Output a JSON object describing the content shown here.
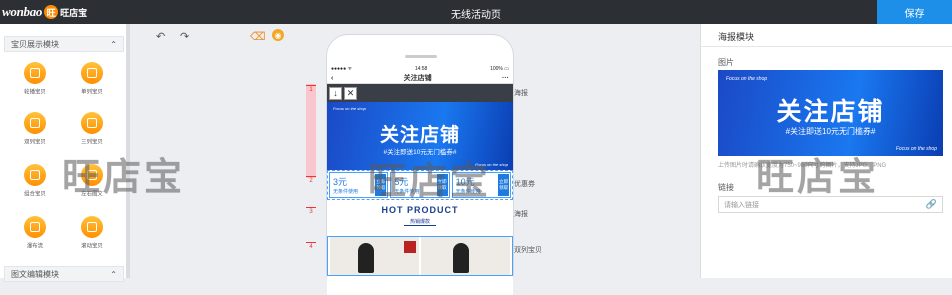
{
  "header": {
    "logo_text": "wonbao",
    "logo_badge": "旺",
    "logo_cn": "旺店宝",
    "title": "无线活动页",
    "save_label": "保存"
  },
  "left_panel": {
    "group1_title": "宝贝展示模块",
    "group2_title": "图文编辑模块",
    "items": [
      {
        "label": "轮播宝贝"
      },
      {
        "label": "单列宝贝"
      },
      {
        "label": "双列宝贝"
      },
      {
        "label": "三列宝贝"
      },
      {
        "label": "组合宝贝"
      },
      {
        "label": "左右图文"
      },
      {
        "label": "瀑布流"
      },
      {
        "label": "滚动宝贝"
      }
    ]
  },
  "phone": {
    "status_left": "●●●●● ᯤ",
    "status_time": "14:58",
    "status_right": "100% ▭",
    "nav_back": "‹",
    "nav_title": "关注店铺",
    "nav_more": "···",
    "banner_small": "Focus on the shop",
    "banner_title": "关注店铺",
    "banner_sub": "#关注即送10元无门槛券#",
    "banner_small2": "Focus on the shop",
    "coupons": [
      {
        "amount": "3元",
        "cond": "无条件使用",
        "get": "立即领取"
      },
      {
        "amount": "5元",
        "cond": "无条件使用",
        "get": "立即领取"
      },
      {
        "amount": "10元",
        "cond": "无条件使用",
        "get": "立即领取"
      }
    ],
    "hot_title": "HOT PRODUCT",
    "hot_sub": "热销爆款"
  },
  "ruler": {
    "marks": [
      "1",
      "2",
      "3",
      "4"
    ],
    "labels": [
      "海报",
      "优惠券",
      "海报",
      "双列宝贝"
    ]
  },
  "right_panel": {
    "title": "海报模块",
    "image_label": "图片",
    "banner_small": "Focus on the shop",
    "banner_title": "关注店铺",
    "banner_sub": "#关注即送10元无门槛券#",
    "banner_small2": "Focus on the shop",
    "hint": "上传图片时请确认宽度为750~960尺寸的图片，支持JPG、PNG",
    "link_label": "链接",
    "link_placeholder": "请输入链接"
  },
  "watermark": "旺店宝"
}
